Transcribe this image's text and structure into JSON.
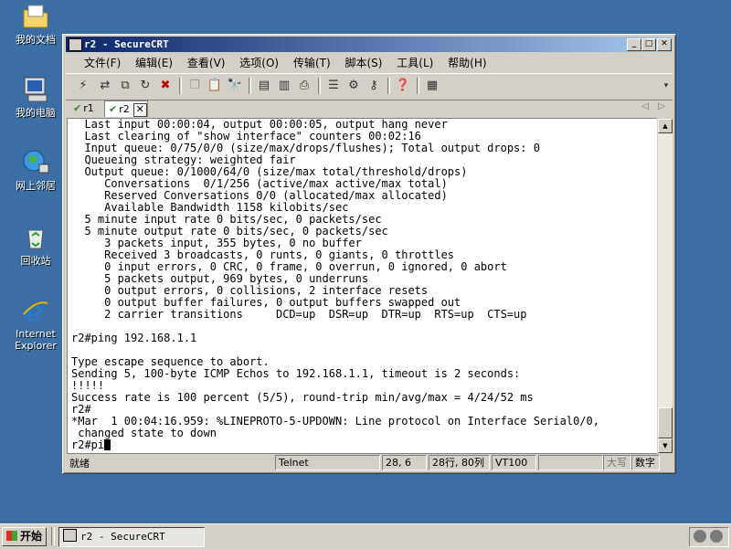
{
  "desktop": {
    "icons": [
      {
        "label": "我的文档"
      },
      {
        "label": "我的电脑"
      },
      {
        "label": "网上邻居"
      },
      {
        "label": "回收站"
      },
      {
        "label": "Internet Explorer"
      }
    ]
  },
  "window": {
    "title": "r2 - SecureCRT",
    "menu": [
      "文件(F)",
      "编辑(E)",
      "查看(V)",
      "选项(O)",
      "传输(T)",
      "脚本(S)",
      "工具(L)",
      "帮助(H)"
    ],
    "tabs": [
      {
        "label": "r1",
        "active": false
      },
      {
        "label": "r2",
        "active": true
      }
    ],
    "terminal_lines": [
      "  Last input 00:00:04, output 00:00:05, output hang never",
      "  Last clearing of \"show interface\" counters 00:02:16",
      "  Input queue: 0/75/0/0 (size/max/drops/flushes); Total output drops: 0",
      "  Queueing strategy: weighted fair",
      "  Output queue: 0/1000/64/0 (size/max total/threshold/drops)",
      "     Conversations  0/1/256 (active/max active/max total)",
      "     Reserved Conversations 0/0 (allocated/max allocated)",
      "     Available Bandwidth 1158 kilobits/sec",
      "  5 minute input rate 0 bits/sec, 0 packets/sec",
      "  5 minute output rate 0 bits/sec, 0 packets/sec",
      "     3 packets input, 355 bytes, 0 no buffer",
      "     Received 3 broadcasts, 0 runts, 0 giants, 0 throttles",
      "     0 input errors, 0 CRC, 0 frame, 0 overrun, 0 ignored, 0 abort",
      "     5 packets output, 969 bytes, 0 underruns",
      "     0 output errors, 0 collisions, 2 interface resets",
      "     0 output buffer failures, 0 output buffers swapped out",
      "     2 carrier transitions     DCD=up  DSR=up  DTR=up  RTS=up  CTS=up",
      "",
      "r2#ping 192.168.1.1",
      "",
      "Type escape sequence to abort.",
      "Sending 5, 100-byte ICMP Echos to 192.168.1.1, timeout is 2 seconds:",
      "!!!!!",
      "Success rate is 100 percent (5/5), round-trip min/avg/max = 4/24/52 ms",
      "r2#",
      "*Mar  1 00:04:16.959: %LINEPROTO-5-UPDOWN: Line protocol on Interface Serial0/0,",
      " changed state to down"
    ],
    "prompt": "r2#pi",
    "status": {
      "ready": "就绪",
      "protocol": "Telnet",
      "cursor_pos": "28,  6",
      "rows_cols": "28行, 80列",
      "emulation": "VT100",
      "caps": "大写",
      "num": "数字"
    }
  },
  "taskbar": {
    "start_label": "开始",
    "task_item": "r2 - SecureCRT"
  }
}
